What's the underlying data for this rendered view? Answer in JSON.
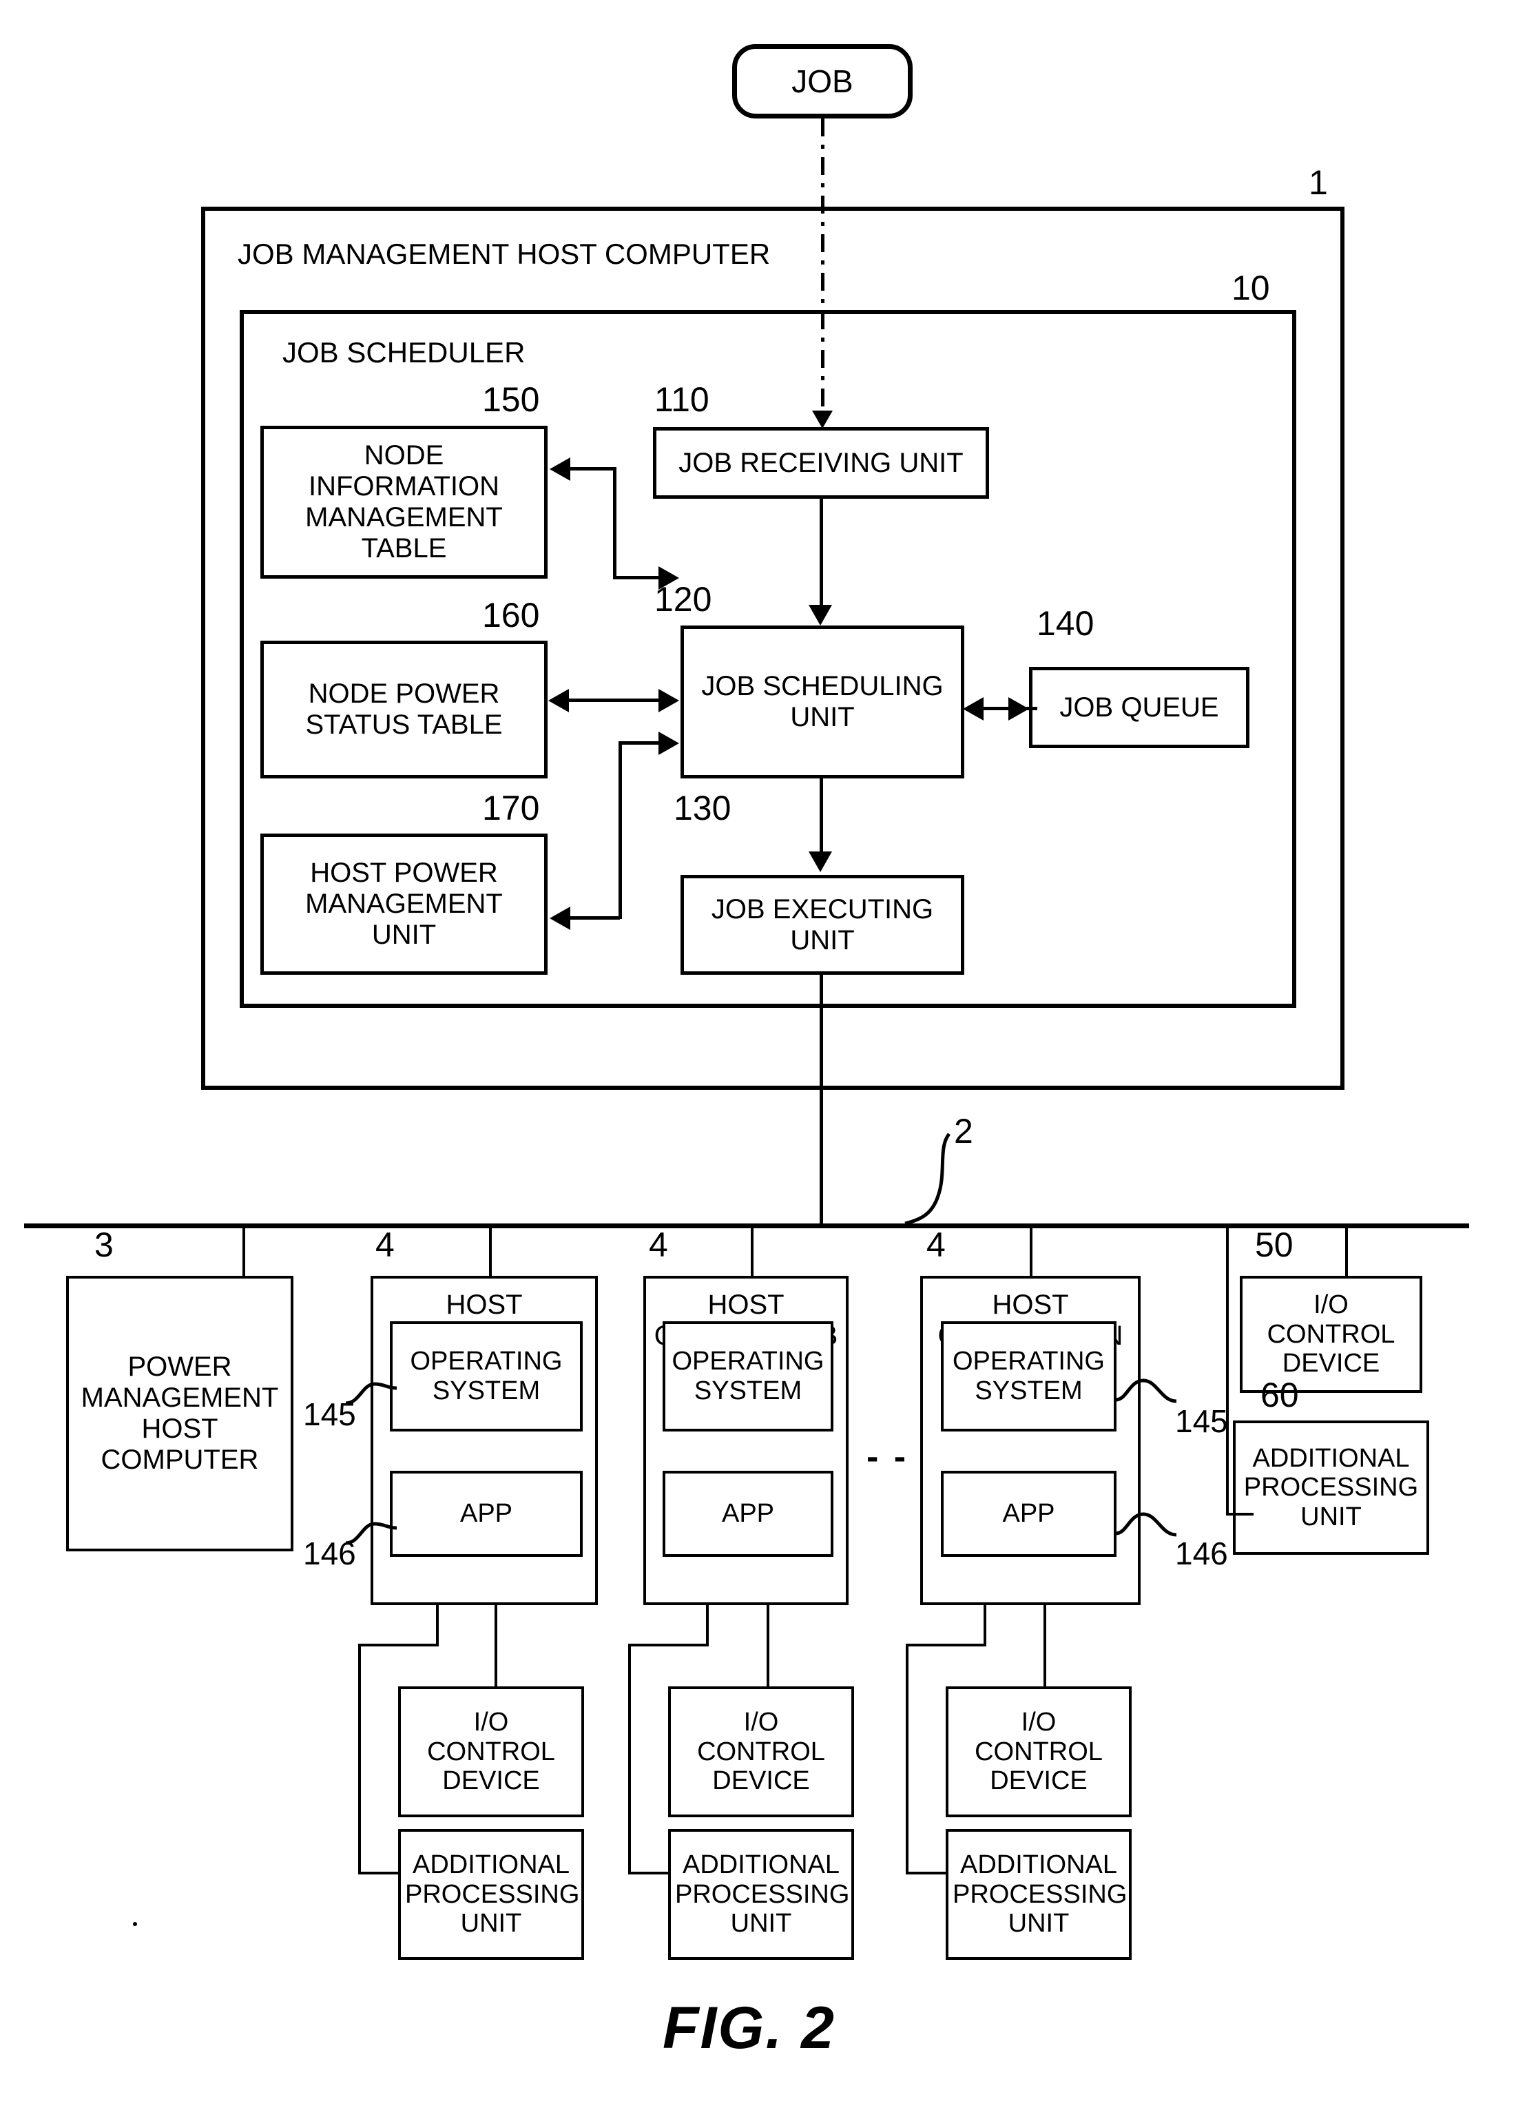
{
  "figure": {
    "caption": "FIG. 2"
  },
  "job_input": {
    "label": "JOB"
  },
  "system": {
    "ref": "1",
    "title": "JOB MANAGEMENT HOST COMPUTER"
  },
  "scheduler": {
    "ref": "10",
    "title": "JOB SCHEDULER",
    "blocks": [
      {
        "ref": "150",
        "label": "NODE\nINFORMATION\nMANAGEMENT\nTABLE"
      },
      {
        "ref": "160",
        "label": "NODE POWER\nSTATUS TABLE"
      },
      {
        "ref": "170",
        "label": "HOST POWER\nMANAGEMENT\nUNIT"
      },
      {
        "ref": "110",
        "label": "JOB RECEIVING UNIT"
      },
      {
        "ref": "120",
        "label": "JOB SCHEDULING\nUNIT"
      },
      {
        "ref": "130",
        "label": "JOB EXECUTING\nUNIT"
      },
      {
        "ref": "140",
        "label": "JOB QUEUE"
      }
    ]
  },
  "network": {
    "ref": "2"
  },
  "power_mgmt_host": {
    "ref": "3",
    "label": "POWER\nMANAGEMENT\nHOST\nCOMPUTER"
  },
  "hosts": [
    {
      "ref": "4",
      "label": "HOST\nCOMPUTER A",
      "os": {
        "ref": "145",
        "label": "OPERATING\nSYSTEM"
      },
      "app": {
        "ref": "146",
        "label": "APP"
      },
      "io": {
        "label": "I/O\nCONTROL\nDEVICE"
      },
      "apu": {
        "label": "ADDITIONAL\nPROCESSING\nUNIT"
      }
    },
    {
      "ref": "4",
      "label": "HOST\nCOMPUTER B",
      "os": {
        "ref": "",
        "label": "OPERATING\nSYSTEM"
      },
      "app": {
        "ref": "",
        "label": "APP"
      },
      "io": {
        "label": "I/O\nCONTROL\nDEVICE"
      },
      "apu": {
        "label": "ADDITIONAL\nPROCESSING\nUNIT"
      }
    },
    {
      "ref": "4",
      "label": "HOST\nCOMPUTER N",
      "os": {
        "ref": "145",
        "label": "OPERATING\nSYSTEM"
      },
      "app": {
        "ref": "146",
        "label": "APP"
      },
      "io": {
        "label": "I/O\nCONTROL\nDEVICE"
      },
      "apu": {
        "label": "ADDITIONAL\nPROCESSING\nUNIT"
      }
    }
  ],
  "shared_io": {
    "ref": "50",
    "label": "I/O\nCONTROL\nDEVICE"
  },
  "shared_apu": {
    "ref": "60",
    "label": "ADDITIONAL\nPROCESSING\nUNIT"
  },
  "continuation": {
    "label": "- -"
  },
  "colors": {
    "ink": "#000000",
    "paper": "#ffffff"
  }
}
